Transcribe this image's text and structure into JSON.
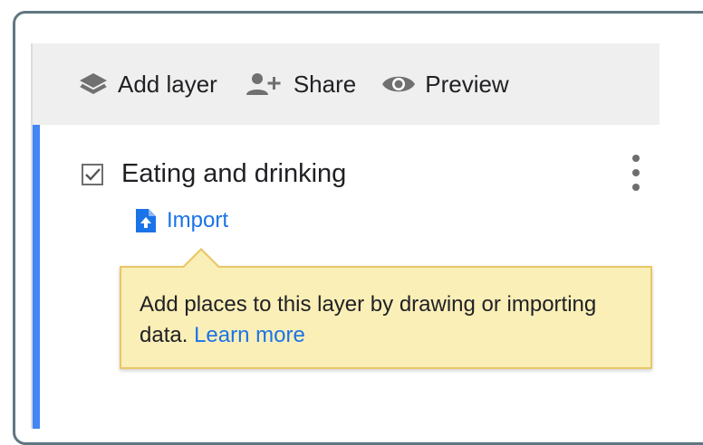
{
  "toolbar": {
    "add_layer": "Add layer",
    "share": "Share",
    "preview": "Preview"
  },
  "layer": {
    "name": "Eating and drinking",
    "checked": true,
    "import_label": "Import"
  },
  "tooltip": {
    "text": "Add places to this layer by drawing or importing data.",
    "link": "Learn more"
  },
  "colors": {
    "accent": "#4285f4",
    "link": "#1a73e8",
    "tooltip_bg": "#fbefb8",
    "tooltip_border": "#e8c766",
    "toolbar_bg": "#efefef",
    "frame_border": "#5f7782"
  },
  "icons": {
    "add_layer": "layers-icon",
    "share": "person-add-icon",
    "preview": "eye-icon",
    "import": "file-upload-icon",
    "checkbox": "checkbox-checked-icon",
    "menu": "more-vert-icon"
  }
}
